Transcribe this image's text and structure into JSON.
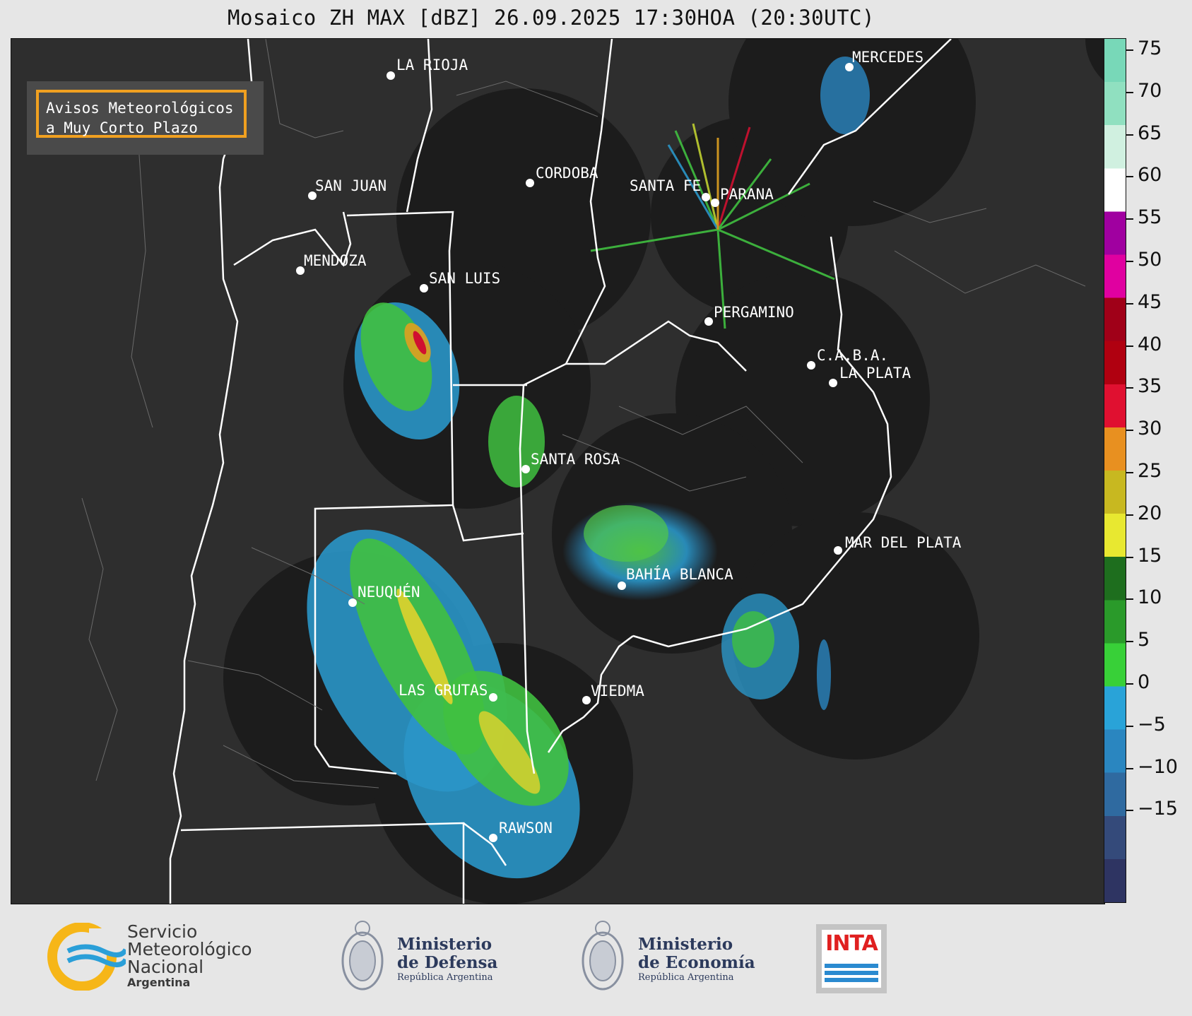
{
  "title": "Mosaico ZH MAX [dBZ] 26.09.2025 17:30HOA (20:30UTC)",
  "notice": {
    "line1": "Avisos Meteorológicos",
    "line2": "a Muy Corto Plazo"
  },
  "cities": {
    "la_rioja": "LA RIOJA",
    "mercedes": "MERCEDES",
    "cordoba": "CORDOBA",
    "san_juan": "SAN JUAN",
    "santa_fe": "SANTA FE",
    "parana": "PARANA",
    "mendoza": "MENDOZA",
    "san_luis": "SAN LUIS",
    "pergamino": "PERGAMINO",
    "caba": "C.A.B.A.",
    "la_plata": "LA PLATA",
    "santa_rosa": "SANTA ROSA",
    "mar_del_plata": "MAR DEL PLATA",
    "bahia_blanca": "BAHÍA BLANCA",
    "neuquen": "NEUQUÉN",
    "las_grutas": "LAS GRUTAS",
    "viedma": "VIEDMA",
    "rawson": "RAWSON"
  },
  "colorbar": {
    "unit": "dBZ",
    "ticks": [
      "75",
      "70",
      "65",
      "60",
      "55",
      "50",
      "45",
      "40",
      "35",
      "30",
      "25",
      "20",
      "15",
      "10",
      "5",
      "0",
      "−5",
      "−10",
      "−15"
    ],
    "colors": [
      "#2e3462",
      "#344a7a",
      "#2f6aa0",
      "#2a86c0",
      "#29a3d8",
      "#38d038",
      "#2a9a2a",
      "#1e6e1e",
      "#e8e830",
      "#c8b820",
      "#e89020",
      "#e01030",
      "#b00010",
      "#a00018",
      "#e000a0",
      "#a000a0",
      "#ffffff",
      "#d0f0e0",
      "#90e0c0",
      "#78d8b8"
    ]
  },
  "footer": {
    "smn": {
      "line1": "Servicio",
      "line2": "Meteorológico",
      "line3": "Nacional",
      "line4": "Argentina"
    },
    "defensa": {
      "line1": "Ministerio",
      "line2": "de Defensa",
      "line3": "República Argentina"
    },
    "economia": {
      "line1": "Ministerio",
      "line2": "de Economía",
      "line3": "República Argentina"
    },
    "inta": "INTA"
  }
}
